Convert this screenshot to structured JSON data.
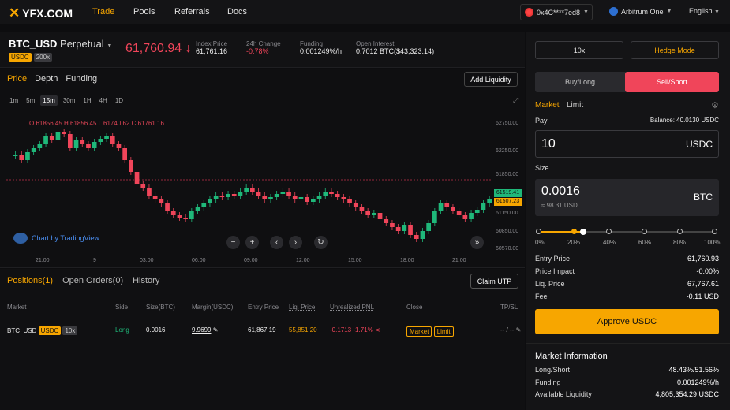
{
  "nav": {
    "logo": "YFX.COM",
    "links": [
      "Trade",
      "Pools",
      "Referrals",
      "Docs"
    ],
    "wallet": "0x4C****7ed8",
    "network": "Arbitrum One",
    "language": "English"
  },
  "ticker": {
    "symbol": "BTC_USD",
    "type": "Perpetual",
    "collateral": "USDC",
    "leverage_badge": "200x",
    "price": "61,760.94",
    "arrow": "↓",
    "stats": [
      {
        "label": "Index Price",
        "value": "61,761.16"
      },
      {
        "label": "24h Change",
        "value": "-0.78%"
      },
      {
        "label": "Funding",
        "value": "0.001249%/h"
      },
      {
        "label": "Open Interest",
        "value": "0.7012 BTC($43,323.14)"
      }
    ]
  },
  "chart": {
    "tabs": [
      "Price",
      "Depth",
      "Funding"
    ],
    "add_liquidity": "Add Liquidity",
    "timeframes": [
      "1m",
      "5m",
      "15m",
      "30m",
      "1H",
      "4H",
      "1D"
    ],
    "selected_tf": "15m",
    "ohlc": "O 61856.45  H 61856.45  L 61740.62  C 61761.16",
    "y_ticks": [
      "62750.00",
      "62250.00",
      "61850.00",
      "61150.00",
      "60850.00",
      "60570.00"
    ],
    "price_tags": {
      "green": "61519.41",
      "orange": "61507.23"
    },
    "x_ticks": [
      "21:00",
      "9",
      "03:00",
      "06:00",
      "09:00",
      "12:00",
      "15:00",
      "18:00",
      "21:00"
    ],
    "tradingview": "Chart by TradingView"
  },
  "positions": {
    "tabs": [
      "Positions(1)",
      "Open Orders(0)",
      "History"
    ],
    "claim": "Claim UTP",
    "headers": [
      "Market",
      "Side",
      "Size(BTC)",
      "Margin(USDC)",
      "Entry Price",
      "Liq. Price",
      "Unrealized PNL",
      "Close",
      "TP/SL"
    ],
    "row": {
      "market": "BTC_USD",
      "collateral": "USDC",
      "lev": "10x",
      "side": "Long",
      "size": "0.0016",
      "margin": "9.9699",
      "entry": "61,867.19",
      "liq": "55,851.20",
      "pnl": "-0.1713 -1.71%",
      "close_market": "Market",
      "close_limit": "Limit",
      "tpsl": "-- / --"
    }
  },
  "order": {
    "leverage": "10x",
    "mode": "Hedge Mode",
    "buy": "Buy/Long",
    "sell": "Sell/Short",
    "order_types": [
      "Market",
      "Limit"
    ],
    "pay_label": "Pay",
    "balance": "Balance:  40.0130 USDC",
    "pay_value": "10",
    "pay_unit": "USDC",
    "size_label": "Size",
    "size_value": "0.0016",
    "size_usd": "≈ 98.31 USD",
    "size_unit": "BTC",
    "slider_pcts": [
      "0%",
      "20%",
      "40%",
      "60%",
      "80%",
      "100%"
    ],
    "details": [
      {
        "label": "Entry Price",
        "value": "61,760.93"
      },
      {
        "label": "Price Impact",
        "value": "-0.00%"
      },
      {
        "label": "Liq. Price",
        "value": "67,767.61"
      },
      {
        "label": "Fee",
        "value": "-0.11 USD"
      }
    ],
    "approve": "Approve USDC"
  },
  "market_info": {
    "title": "Market Information",
    "rows": [
      {
        "label": "Long/Short",
        "value": "48.43%/51.56%"
      },
      {
        "label": "Funding",
        "value": "0.001249%/h"
      },
      {
        "label": "Available Liquidity",
        "value": "4,805,354.29 USDC"
      }
    ]
  },
  "colors": {
    "accent": "#f7a600",
    "up": "#1fb87a",
    "down": "#f0455a"
  }
}
